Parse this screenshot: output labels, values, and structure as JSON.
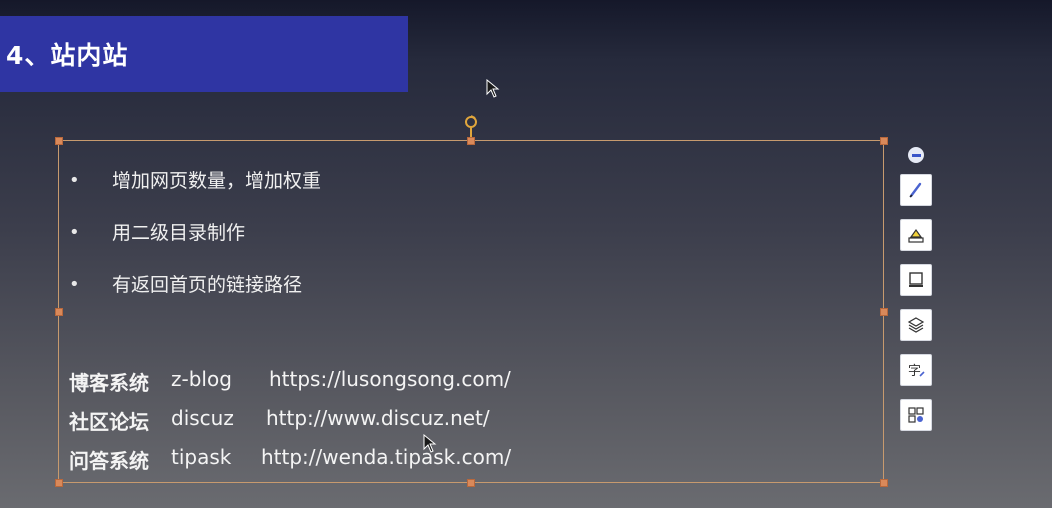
{
  "slide": {
    "title": "4、站内站",
    "bullets": [
      {
        "dot": "•",
        "text": "增加网页数量，增加权重"
      },
      {
        "dot": "•",
        "text": "用二级目录制作"
      },
      {
        "dot": "•",
        "text": "有返回首页的链接路径"
      }
    ],
    "sites": [
      {
        "name": "博客系统",
        "system": "z-blog",
        "url": "https://lusongsong.com/"
      },
      {
        "name": "社区论坛",
        "system": "discuz",
        "url": "http://www.discuz.net/"
      },
      {
        "name": "问答系统",
        "system": "tipask",
        "url": "http://wenda.tipask.com/"
      }
    ]
  },
  "toolbar": {
    "items": [
      "minus-icon",
      "pen-icon",
      "highlighter-icon",
      "screen-icon",
      "layers-icon",
      "text-style-icon",
      "puzzle-icon"
    ],
    "char_icon_glyph": "字"
  },
  "colors": {
    "title_bg": "#2f35a3",
    "selection_border": "#c79a6e",
    "handle": "#d9895a",
    "accent_blue": "#3a55c8"
  }
}
